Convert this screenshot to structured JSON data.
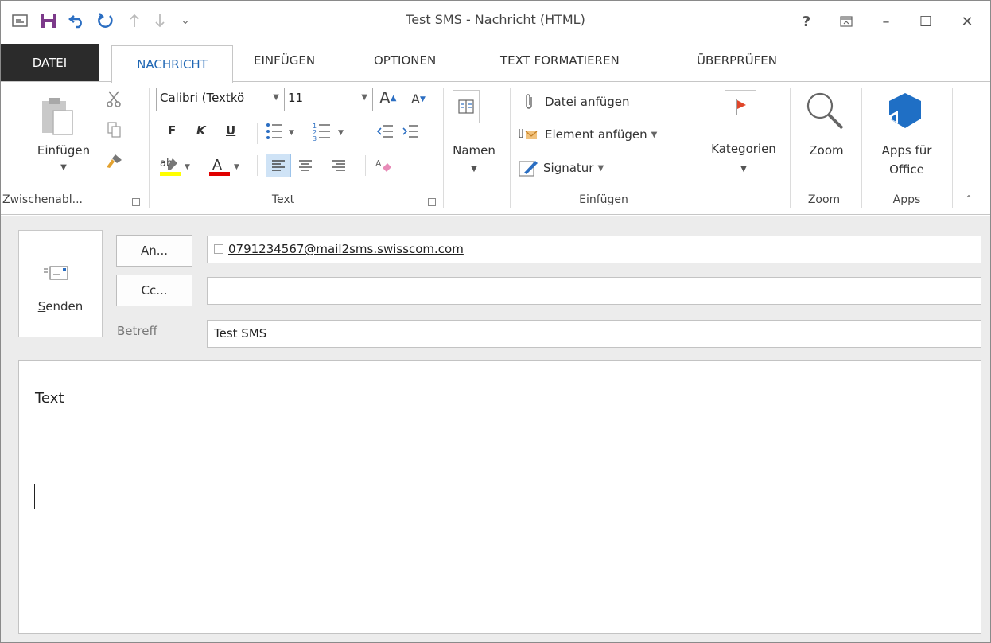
{
  "window": {
    "title": "Test SMS - Nachricht (HTML)",
    "help": "?",
    "minimize": "–",
    "maximize": "☐",
    "close": "✕"
  },
  "qat": {
    "more": "⌄"
  },
  "tabs": {
    "file": "DATEI",
    "active": "NACHRICHT",
    "items": [
      "EINFÜGEN",
      "OPTIONEN",
      "TEXT FORMATIEREN",
      "ÜBERPRÜFEN"
    ]
  },
  "ribbon": {
    "clipboard": {
      "paste": "Einfügen",
      "group": "Zwischenabl..."
    },
    "text": {
      "font": "Calibri (Textkö",
      "size": "11",
      "bold": "F",
      "italic": "K",
      "underline": "U",
      "group": "Text"
    },
    "names": {
      "label": "Namen"
    },
    "insert": {
      "attach_file": "Datei anfügen",
      "attach_item": "Element anfügen",
      "signature": "Signatur",
      "group": "Einfügen"
    },
    "tags": {
      "categories": "Kategorien"
    },
    "zoom": {
      "label": "Zoom",
      "group": "Zoom"
    },
    "apps": {
      "label_line1": "Apps für",
      "label_line2": "Office",
      "group": "Apps"
    }
  },
  "compose": {
    "send": "Senden",
    "to_button": "An...",
    "cc_button": "Cc...",
    "subject_label": "Betreff",
    "to_value": "0791234567@mail2sms.swisscom.com",
    "cc_value": "",
    "subject_value": "Test SMS",
    "body_text": "Text"
  },
  "colors": {
    "accent": "#1e66b4",
    "file_tab_bg": "#2b2b2b",
    "save_icon": "#7c3a8a",
    "highlight": "#ffff00",
    "font_color": "#e00000",
    "flag": "#e0462a",
    "apps_icon": "#1f6fc5"
  }
}
